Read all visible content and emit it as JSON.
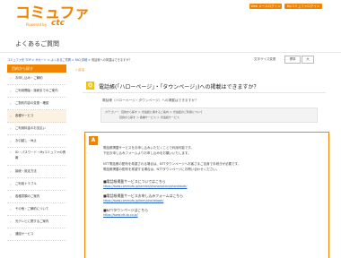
{
  "header": {
    "logo_text": "コミュファ",
    "logo_powered": "Powered by",
    "logo_ctc": "ctc",
    "top_buttons": [
      "Web メールログイン",
      "Myコミュファログイン"
    ]
  },
  "page_title": "よくあるご質問",
  "breadcrumb": {
    "items": [
      "コミュファ光 TOP",
      "サポート",
      "よくあるご質問",
      "FAQ 詳細"
    ],
    "current": "電話帳への掲載はできますか？"
  },
  "text_size": {
    "label": "文字サイズ変更",
    "options": [
      "標準",
      "大"
    ]
  },
  "sidebar": {
    "heading": "目的から探す",
    "items": [
      "お申し込み・ご解約",
      "ご利用開始・接続までのご案内",
      "ご契約内容の変更・確認",
      "各種サービス",
      "ご利用料金のお支払い",
      "お引越し・休止",
      "ID・パスワード・Myコミュファの情報",
      "接続・設定方法",
      "ご利用トラブル",
      "各種書類のご案内",
      "その他・ご解約について",
      "光テレビに関するご案内",
      "通話サービス"
    ]
  },
  "main": {
    "back_link": "戻る",
    "question": "電話帳(「ハローページ」・「タウンページ」)への掲載はできますか？",
    "question_detail": "電話帳（ハローページ・タウンページ）への掲載はできますか？",
    "categories": [
      "カテゴリー：目的から探す ＞ 光電話に関するご案内 ＞ 光電話のご利用について",
      "目的から探す ＞ 各種サービス ＞ 光電話サービス"
    ],
    "answer_lines": [
      "電話帳掲載サービスをお申し込みいただくことで利用可能です。",
      "下記お申し込みフォームよりお申し込みをお願いいたします。",
      "NTT電話帳の配布を希望される場合は、NTTタウンページへお客さまご自身で手続きが必要です。",
      "電話帳掲載の配布を希望する場合は、NTTタウンページにお問い合わせください。"
    ],
    "links": [
      {
        "title": "■電話帳掲載サービスについてはこちら",
        "url": "https://www.commufa.jp/service/phone/option/phonebook/"
      },
      {
        "title": "■電話帳掲載サービスお申し込みフォームはこちら",
        "url": "https://www.commufa.jp/form/phonebook/"
      },
      {
        "title": "■NTTタウンページはこちら",
        "url": "https://www.ntt-tp.co.jp/"
      }
    ]
  }
}
